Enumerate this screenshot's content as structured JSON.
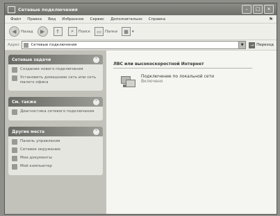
{
  "window": {
    "title": "Сетевые подключения"
  },
  "menu": [
    "Файл",
    "Правка",
    "Вид",
    "Избранное",
    "Сервис",
    "Дополнительно",
    "Справка"
  ],
  "toolbar": {
    "back_label": "Назад",
    "search_label": "Поиск",
    "folders_label": "Папки"
  },
  "address": {
    "label": "Адрес",
    "value": "Сетевые подключения",
    "go_label": "Переход"
  },
  "sidebar": {
    "network_tasks": {
      "title": "Сетевые задачи",
      "items": [
        "Создание нового подключения",
        "Установить домашнюю сеть или сеть малого офиса"
      ]
    },
    "see_also": {
      "title": "См. также",
      "items": [
        "Диагностика сетевого подключения"
      ]
    },
    "other_places": {
      "title": "Другие места",
      "items": [
        "Панель управления",
        "Сетевое окружение",
        "Мои документы",
        "Мой компьютер"
      ]
    }
  },
  "main": {
    "group_title": "ЛВС или высокоскоростной Интернет",
    "connection": {
      "name": "Подключение по локальной сети",
      "status": "Включено"
    }
  }
}
